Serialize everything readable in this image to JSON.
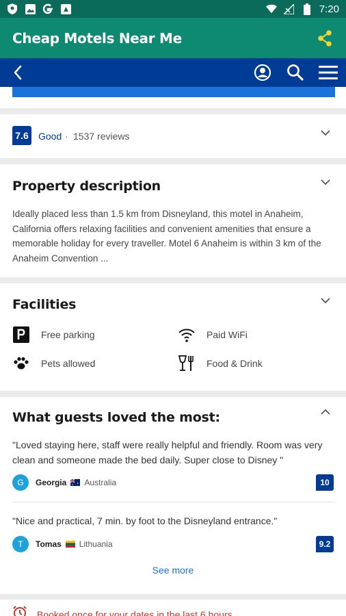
{
  "status_bar": {
    "time": "7:20",
    "icons": [
      "shield-icon",
      "image-icon",
      "google-icon",
      "box-icon",
      "wifi-icon",
      "signal-icon",
      "battery-icon"
    ]
  },
  "app_bar": {
    "title": "Cheap Motels Near Me",
    "share_icon": "share-icon"
  },
  "nav_bar": {
    "back_icon": "back-arrow-icon",
    "account_icon": "account-icon",
    "search_icon": "search-icon",
    "menu_icon": "menu-icon"
  },
  "rating": {
    "score": "7.6",
    "word": "Good",
    "separator": "·",
    "reviews": "1537 reviews"
  },
  "description": {
    "title": "Property description",
    "text": "Ideally placed less than 1.5 km from Disneyland, this motel in Anaheim, California offers relaxing facilities and convenient amenities that ensure a memorable holiday for every traveller. Motel 6 Anaheim is within 3 km of the Anaheim Convention ..."
  },
  "facilities": {
    "title": "Facilities",
    "items": [
      {
        "label": "Free parking",
        "icon": "parking-icon"
      },
      {
        "label": "Paid WiFi",
        "icon": "wifi-icon"
      },
      {
        "label": "Pets allowed",
        "icon": "paw-icon"
      },
      {
        "label": "Food & Drink",
        "icon": "food-drink-icon"
      }
    ]
  },
  "guests": {
    "title": "What guests loved the most:",
    "reviews": [
      {
        "quote": "\"Loved staying here, staff were really helpful and friendly. Room was very clean and someone made the bed daily. Super close to Disney \"",
        "initial": "G",
        "name": "Georgia",
        "country": "Australia",
        "score": "10"
      },
      {
        "quote": "\"Nice and practical, 7 min. by foot to the Disneyland entrance.\"",
        "initial": "T",
        "name": "Tomas",
        "country": "Lithuania",
        "score": "9.2"
      }
    ],
    "see_more": "See more"
  },
  "booked": {
    "text": "Booked once for your dates in the last 6 hours",
    "icon": "alarm-clock-icon"
  },
  "colors": {
    "status_bar": "#0b6b5b",
    "app_bar": "#0e8a72",
    "nav_bar": "#003c95",
    "accent_blue": "#1a73d8",
    "share_icon": "#f1d633",
    "alert_red": "#c0392b"
  }
}
